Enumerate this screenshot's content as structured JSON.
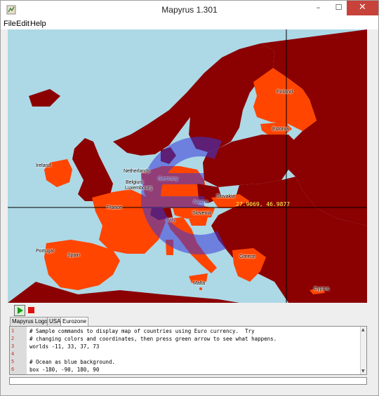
{
  "window": {
    "title": "Mapyrus 1.301",
    "controls": {
      "minimize": "–",
      "maximize": "☐",
      "close": "✕"
    }
  },
  "menu": [
    "File",
    "Edit",
    "Help"
  ],
  "map": {
    "colors": {
      "sea": "#add8e6",
      "non_euro_country": "#8b0000",
      "euro_country": "#ff4500",
      "euro_symbol": "#3a3ad8",
      "crosshair": "#000000"
    },
    "country_labels": {
      "finland": "Finland",
      "estonia": "Estonia",
      "ireland": "Ireland",
      "netherlands": "Netherlands",
      "germany": "Germany",
      "belgium": "Belgium",
      "luxembourg": "Luxembourg",
      "slovakia": "Slovakia",
      "austria": "Austria",
      "france": "France",
      "slovenia": "Slovenia",
      "italy": "Italy",
      "portugal": "Portugal",
      "spain": "Spain",
      "greece": "Greece",
      "malta": "Malta",
      "cyprus": "Cyprus"
    },
    "coordinate_readout": "27.9069, 46.9877"
  },
  "toolbar": {
    "run_icon": "play-icon",
    "stop_icon": "stop-icon"
  },
  "tabs": [
    {
      "label": "Mapyrus Logo",
      "active": false
    },
    {
      "label": "USA",
      "active": false
    },
    {
      "label": "Eurozone",
      "active": true
    }
  ],
  "editor": {
    "lines": [
      {
        "no": "1",
        "text": "# Sample commands to display map of countries using Euro currency.  Try"
      },
      {
        "no": "2",
        "text": "# changing colors and coordinates, then press green arrow to see what happens."
      },
      {
        "no": "3",
        "text": "worlds -11, 33, 37, 73"
      },
      {
        "no": "4",
        "text": ""
      },
      {
        "no": "5",
        "text": "# Ocean as blue background."
      },
      {
        "no": "6",
        "text": "box -180, -90, 180, 90"
      }
    ]
  },
  "status": ""
}
